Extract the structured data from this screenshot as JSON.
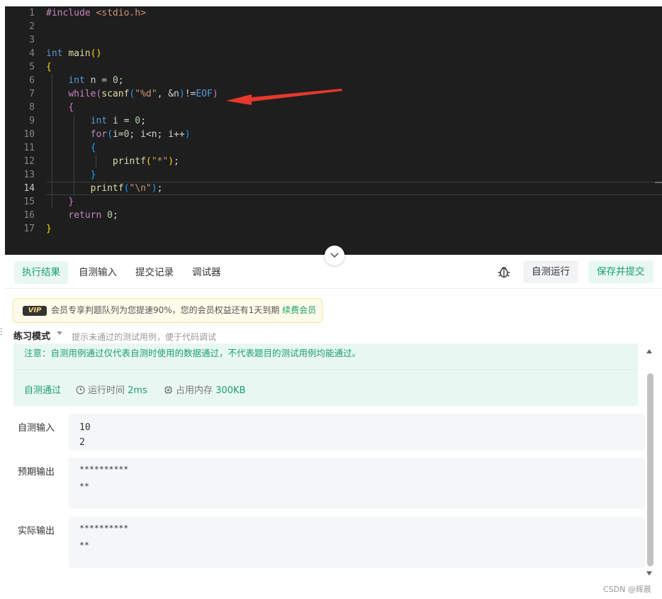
{
  "editor": {
    "lines": [
      {
        "num": "1",
        "parts": [
          {
            "t": "#include ",
            "c": "macro"
          },
          {
            "t": "<stdio.h>",
            "c": "str"
          }
        ]
      },
      {
        "num": "2",
        "parts": []
      },
      {
        "num": "3",
        "parts": []
      },
      {
        "num": "4",
        "parts": [
          {
            "t": "int ",
            "c": "kw"
          },
          {
            "t": "main",
            "c": "fn"
          },
          {
            "t": "()",
            "c": "br1"
          }
        ]
      },
      {
        "num": "5",
        "parts": [
          {
            "t": "{",
            "c": "br1"
          }
        ]
      },
      {
        "num": "6",
        "parts": [
          {
            "t": "    "
          },
          {
            "t": "int ",
            "c": "kw"
          },
          {
            "t": "n = "
          },
          {
            "t": "0",
            "c": "num"
          },
          {
            "t": ";"
          }
        ]
      },
      {
        "num": "7",
        "parts": [
          {
            "t": "    "
          },
          {
            "t": "while",
            "c": "macro"
          },
          {
            "t": "(",
            "c": "br2"
          },
          {
            "t": "scanf",
            "c": "fn"
          },
          {
            "t": "(",
            "c": "br3"
          },
          {
            "t": "\"%d\"",
            "c": "str"
          },
          {
            "t": ", &n"
          },
          {
            "t": ")",
            "c": "br3"
          },
          {
            "t": "!="
          },
          {
            "t": "EOF",
            "c": "kw"
          },
          {
            "t": ")",
            "c": "br2"
          }
        ]
      },
      {
        "num": "8",
        "parts": [
          {
            "t": "    "
          },
          {
            "t": "{",
            "c": "br2"
          }
        ]
      },
      {
        "num": "9",
        "parts": [
          {
            "t": "        "
          },
          {
            "t": "int ",
            "c": "kw"
          },
          {
            "t": "i = "
          },
          {
            "t": "0",
            "c": "num"
          },
          {
            "t": ";"
          }
        ]
      },
      {
        "num": "10",
        "parts": [
          {
            "t": "        "
          },
          {
            "t": "for",
            "c": "macro"
          },
          {
            "t": "(",
            "c": "br3"
          },
          {
            "t": "i="
          },
          {
            "t": "0",
            "c": "num"
          },
          {
            "t": "; i<n; i++"
          },
          {
            "t": ")",
            "c": "br3"
          }
        ]
      },
      {
        "num": "11",
        "parts": [
          {
            "t": "        "
          },
          {
            "t": "{",
            "c": "br3"
          }
        ]
      },
      {
        "num": "12",
        "parts": [
          {
            "t": "            "
          },
          {
            "t": "printf",
            "c": "fn"
          },
          {
            "t": "(",
            "c": "br1"
          },
          {
            "t": "\"*\"",
            "c": "str"
          },
          {
            "t": ")",
            "c": "br1"
          },
          {
            "t": ";"
          }
        ]
      },
      {
        "num": "13",
        "parts": [
          {
            "t": "        "
          },
          {
            "t": "}",
            "c": "br3"
          }
        ]
      },
      {
        "num": "14",
        "parts": [
          {
            "t": "        "
          },
          {
            "t": "printf",
            "c": "fn"
          },
          {
            "t": "(",
            "c": "br3"
          },
          {
            "t": "\"\\n\"",
            "c": "str"
          },
          {
            "t": ")",
            "c": "br3"
          },
          {
            "t": ";"
          }
        ]
      },
      {
        "num": "15",
        "parts": [
          {
            "t": "    "
          },
          {
            "t": "}",
            "c": "br2"
          }
        ]
      },
      {
        "num": "16",
        "parts": [
          {
            "t": "    "
          },
          {
            "t": "return ",
            "c": "macro"
          },
          {
            "t": "0",
            "c": "num"
          },
          {
            "t": ";"
          }
        ]
      },
      {
        "num": "17",
        "parts": [
          {
            "t": "}",
            "c": "br1"
          }
        ]
      }
    ],
    "active_line": 14,
    "arrow_color": "#e8372c"
  },
  "tabs": [
    {
      "label": "执行结果",
      "active": true
    },
    {
      "label": "自测输入",
      "active": false
    },
    {
      "label": "提交记录",
      "active": false
    },
    {
      "label": "调试器",
      "active": false
    }
  ],
  "actions": {
    "run_label": "自测运行",
    "submit_label": "保存并提交"
  },
  "vip": {
    "badge": "VIP",
    "text": "会员专享判题队列为您提速90%，您的会员权益还有1天到期",
    "link": "续费会员"
  },
  "mode": {
    "label": "练习模式",
    "hint": "提示未通过的测试用例，便于代码调试"
  },
  "result": {
    "notice": "注意：自测用例通过仅代表自测时使用的数据通过，不代表题目的测试用例均能通过。",
    "status": "自测通过",
    "time_label": "运行时间",
    "time_value": "2ms",
    "mem_label": "占用内存",
    "mem_value": "300KB"
  },
  "io": {
    "input_label": "自测输入",
    "input_value": "10\n2",
    "expected_label": "预期输出",
    "expected_value": "**********\n**",
    "actual_label": "实际输出",
    "actual_value": "**********\n**"
  },
  "watermark": "CSDN @辉晨",
  "colors": {
    "accent": "#1aa06d",
    "editor_bg": "#1e1e1e"
  }
}
